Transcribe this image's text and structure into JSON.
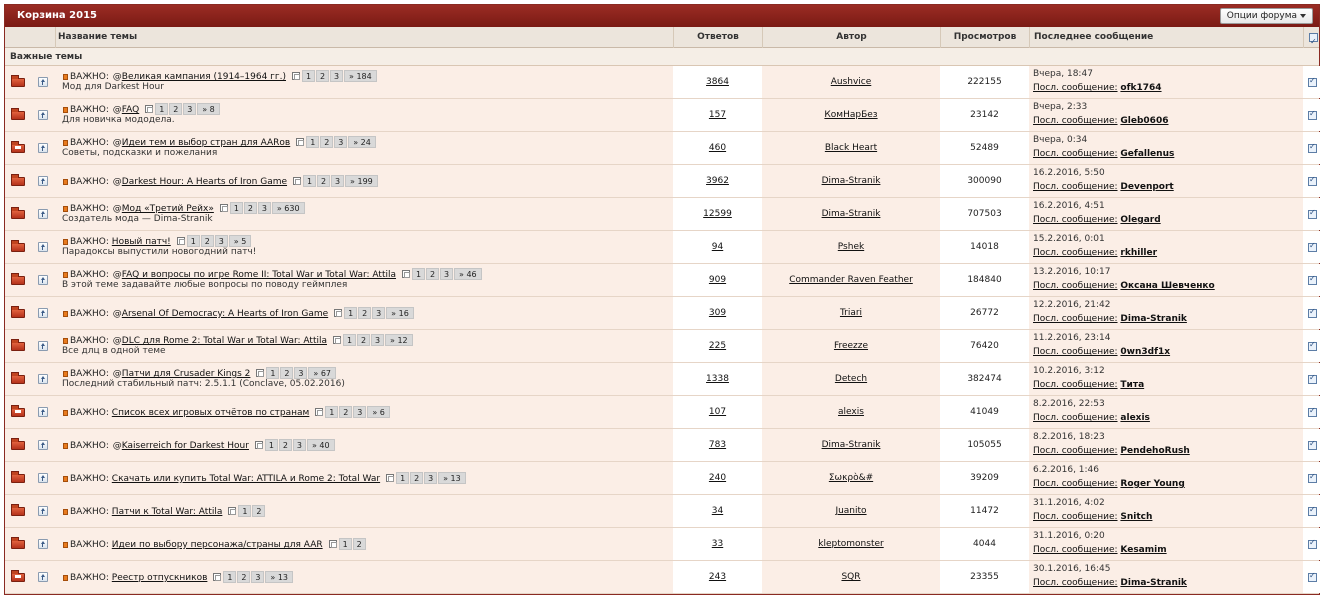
{
  "forum": {
    "title": "Корзина 2015",
    "options_label": "Опции форума"
  },
  "columns": {
    "topic": "Название темы",
    "replies": "Ответов",
    "author": "Автор",
    "views": "Просмотров",
    "last": "Последнее сообщение"
  },
  "section": "Важные темы",
  "important_label": "ВАЖНО:",
  "last_post_label": "Посл. сообщение:",
  "topics": [
    {
      "title": "Великая кампания (1914–1964 гг.)",
      "poll": "@",
      "desc": "Мод для Darkest Hour",
      "pages": [
        "1",
        "2",
        "3",
        "» 184"
      ],
      "replies": "3864",
      "author": "Aushvice",
      "views": "222155",
      "last_time": "Вчера, 18:47",
      "last_user": "ofk1764",
      "folder": "normal"
    },
    {
      "title": "FAQ",
      "poll": "@",
      "desc": "Для новичка мододела.",
      "pages": [
        "1",
        "2",
        "3",
        "» 8"
      ],
      "replies": "157",
      "author": "КомНарБез",
      "views": "23142",
      "last_time": "Вчера, 2:33",
      "last_user": "Gleb0606",
      "folder": "normal"
    },
    {
      "title": "Идеи тем и выбор стран для AARов",
      "poll": "@",
      "desc": "Советы, подсказки и пожелания",
      "pages": [
        "1",
        "2",
        "3",
        "» 24"
      ],
      "replies": "460",
      "author": "Black Heart",
      "views": "52489",
      "last_time": "Вчера, 0:34",
      "last_user": "Gefallenus",
      "folder": "new"
    },
    {
      "title": "Darkest Hour: A Hearts of Iron Game",
      "poll": "@",
      "desc": "",
      "pages": [
        "1",
        "2",
        "3",
        "» 199"
      ],
      "replies": "3962",
      "author": "Dima-Stranik",
      "views": "300090",
      "last_time": "16.2.2016, 5:50",
      "last_user": "Devenport",
      "folder": "normal"
    },
    {
      "title": "Мод «Третий Рейх»",
      "poll": "@",
      "desc": "Создатель мода — Dima-Stranik",
      "pages": [
        "1",
        "2",
        "3",
        "» 630"
      ],
      "replies": "12599",
      "author": "Dima-Stranik",
      "views": "707503",
      "last_time": "16.2.2016, 4:51",
      "last_user": "Olegard",
      "folder": "normal"
    },
    {
      "title": "Новый патч!",
      "poll": "",
      "desc": "Парадоксы выпустили новогодний патч!",
      "pages": [
        "1",
        "2",
        "3",
        "» 5"
      ],
      "replies": "94",
      "author": "Pshek",
      "views": "14018",
      "last_time": "15.2.2016, 0:01",
      "last_user": "rkhiller",
      "folder": "normal"
    },
    {
      "title": "FAQ и вопросы по игре Rome II: Total War и Total War: Attila",
      "poll": "@",
      "desc": "В этой теме задавайте любые вопросы по поводу геймплея",
      "pages": [
        "1",
        "2",
        "3",
        "» 46"
      ],
      "replies": "909",
      "author": "Commander Raven Feather",
      "views": "184840",
      "last_time": "13.2.2016, 10:17",
      "last_user": "Оксана Шевченко",
      "folder": "normal"
    },
    {
      "title": "Arsenal Of Democracy: A Hearts of Iron Game",
      "poll": "@",
      "desc": "",
      "pages": [
        "1",
        "2",
        "3",
        "» 16"
      ],
      "replies": "309",
      "author": "Triari",
      "views": "26772",
      "last_time": "12.2.2016, 21:42",
      "last_user": "Dima-Stranik",
      "folder": "normal"
    },
    {
      "title": "DLC для Rome 2: Total War и Total War: Attila",
      "poll": "@",
      "desc": "Все длц в одной теме",
      "pages": [
        "1",
        "2",
        "3",
        "» 12"
      ],
      "replies": "225",
      "author": "Freezze",
      "views": "76420",
      "last_time": "11.2.2016, 23:14",
      "last_user": "0wn3df1x",
      "folder": "normal"
    },
    {
      "title": "Патчи для Crusader Kings 2",
      "poll": "@",
      "desc": "Последний стабильный патч: 2.5.1.1 (Conclave, 05.02.2016)",
      "pages": [
        "1",
        "2",
        "3",
        "» 67"
      ],
      "replies": "1338",
      "author": "Detech",
      "views": "382474",
      "last_time": "10.2.2016, 3:12",
      "last_user": "Тита",
      "folder": "normal"
    },
    {
      "title": "Список всех игровых отчётов по странам",
      "poll": "",
      "desc": "",
      "pages": [
        "1",
        "2",
        "3",
        "» 6"
      ],
      "replies": "107",
      "author": "alexis",
      "views": "41049",
      "last_time": "8.2.2016, 22:53",
      "last_user": "alexis",
      "folder": "new"
    },
    {
      "title": "Kaiserreich for Darkest Hour",
      "poll": "@",
      "desc": "",
      "pages": [
        "1",
        "2",
        "3",
        "» 40"
      ],
      "replies": "783",
      "author": "Dima-Stranik",
      "views": "105055",
      "last_time": "8.2.2016, 18:23",
      "last_user": "PendehoRush",
      "folder": "normal"
    },
    {
      "title": "Скачать или купить Total War: ATTILA и Rome 2: Total War",
      "poll": "",
      "desc": "",
      "pages": [
        "1",
        "2",
        "3",
        "» 13"
      ],
      "replies": "240",
      "author": "Σωκρὸ&#",
      "views": "39209",
      "last_time": "6.2.2016, 1:46",
      "last_user": "Roger Young",
      "folder": "normal"
    },
    {
      "title": "Патчи к Total War: Attila",
      "poll": "",
      "desc": "",
      "pages": [
        "1",
        "2"
      ],
      "replies": "34",
      "author": "Juanito",
      "views": "11472",
      "last_time": "31.1.2016, 4:02",
      "last_user": "Snitch",
      "folder": "normal"
    },
    {
      "title": "Идеи по выбору персонажа/страны для AAR",
      "poll": "",
      "desc": "",
      "pages": [
        "1",
        "2"
      ],
      "replies": "33",
      "author": "kleptomonster",
      "views": "4044",
      "last_time": "31.1.2016, 0:20",
      "last_user": "Kesamim",
      "folder": "normal"
    },
    {
      "title": "Реестр отпускников",
      "poll": "",
      "desc": "",
      "pages": [
        "1",
        "2",
        "3",
        "» 13"
      ],
      "replies": "243",
      "author": "SQR",
      "views": "23355",
      "last_time": "30.1.2016, 16:45",
      "last_user": "Dima-Stranik",
      "folder": "new"
    }
  ]
}
